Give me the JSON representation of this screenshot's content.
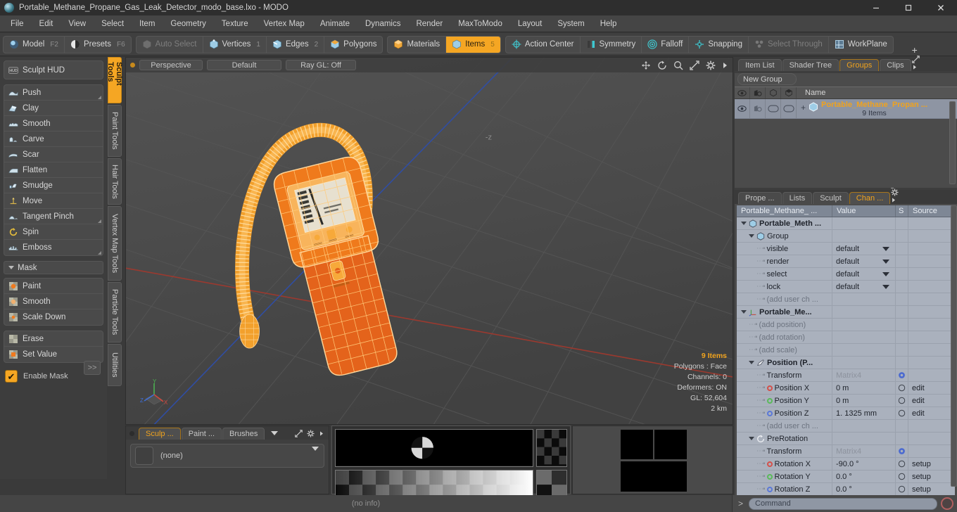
{
  "window": {
    "title": "Portable_Methane_Propane_Gas_Leak_Detector_modo_base.lxo - MODO",
    "logo_icon": "modo-logo-icon",
    "minimize_icon": "minimize-icon",
    "maximize_icon": "maximize-icon",
    "close_icon": "close-icon"
  },
  "menubar": {
    "items": [
      {
        "label": "File"
      },
      {
        "label": "Edit"
      },
      {
        "label": "View"
      },
      {
        "label": "Select"
      },
      {
        "label": "Item"
      },
      {
        "label": "Geometry"
      },
      {
        "label": "Texture"
      },
      {
        "label": "Vertex Map"
      },
      {
        "label": "Animate"
      },
      {
        "label": "Dynamics"
      },
      {
        "label": "Render"
      },
      {
        "label": "MaxToModo"
      },
      {
        "label": "Layout"
      },
      {
        "label": "System"
      },
      {
        "label": "Help"
      }
    ]
  },
  "modebar": {
    "group_mode": [
      {
        "label": "Model",
        "kbd": "F2",
        "icon": "sphere-blue-icon",
        "active": false,
        "dim": false
      },
      {
        "label": "Presets",
        "kbd": "F6",
        "icon": "sphere-half-icon",
        "active": false,
        "dim": false
      }
    ],
    "group_select": [
      {
        "label": "Auto Select",
        "kbd": "",
        "icon": "cube-grey-icon",
        "active": false,
        "dim": true
      },
      {
        "label": "Vertices",
        "kbd": "1",
        "icon": "cube-vertex-icon",
        "active": false,
        "dim": false
      },
      {
        "label": "Edges",
        "kbd": "2",
        "icon": "cube-edge-icon",
        "active": false,
        "dim": false
      },
      {
        "label": "Polygons",
        "kbd": "",
        "icon": "cube-poly-icon",
        "active": false,
        "dim": false
      }
    ],
    "group_items": [
      {
        "label": "Materials",
        "kbd": "",
        "icon": "cube-material-icon",
        "active": false,
        "dim": false
      },
      {
        "label": "Items",
        "kbd": "5",
        "icon": "cube-items-icon",
        "active": true,
        "dim": false
      }
    ],
    "group_tools": [
      {
        "label": "Action Center",
        "kbd": "",
        "icon": "action-center-icon",
        "active": false,
        "dim": false
      },
      {
        "label": "Symmetry",
        "kbd": "",
        "icon": "symmetry-icon",
        "active": false,
        "dim": false
      },
      {
        "label": "Falloff",
        "kbd": "",
        "icon": "falloff-icon",
        "active": false,
        "dim": false
      },
      {
        "label": "Snapping",
        "kbd": "",
        "icon": "snapping-icon",
        "active": false,
        "dim": false
      },
      {
        "label": "Select Through",
        "kbd": "",
        "icon": "select-through-icon",
        "active": false,
        "dim": true
      },
      {
        "label": "WorkPlane",
        "kbd": "",
        "icon": "workplane-icon",
        "active": false,
        "dim": false
      }
    ]
  },
  "left_panel": {
    "hud_button": {
      "label": "Sculpt HUD",
      "icon": "hud-icon"
    },
    "sculpt_tools": [
      {
        "label": "Push",
        "icon": "push-icon",
        "corner": true
      },
      {
        "label": "Clay",
        "icon": "clay-icon",
        "corner": false
      },
      {
        "label": "Smooth",
        "icon": "smooth-icon",
        "corner": false
      },
      {
        "label": "Carve",
        "icon": "carve-icon",
        "corner": false
      },
      {
        "label": "Scar",
        "icon": "scar-icon",
        "corner": false
      },
      {
        "label": "Flatten",
        "icon": "flatten-icon",
        "corner": false
      },
      {
        "label": "Smudge",
        "icon": "smudge-icon",
        "corner": false
      },
      {
        "label": "Move",
        "icon": "move-icon",
        "corner": false
      },
      {
        "label": "Tangent Pinch",
        "icon": "tangent-pinch-icon",
        "corner": true
      },
      {
        "label": "Spin",
        "icon": "spin-icon",
        "corner": false
      },
      {
        "label": "Emboss",
        "icon": "emboss-icon",
        "corner": true
      }
    ],
    "mask_section": {
      "label": "Mask",
      "tools": [
        {
          "label": "Paint",
          "icon": "mask-paint-icon"
        },
        {
          "label": "Smooth",
          "icon": "mask-smooth-icon"
        },
        {
          "label": "Scale Down",
          "icon": "mask-scale-down-icon"
        }
      ],
      "tools2": [
        {
          "label": "Erase",
          "icon": "mask-erase-icon"
        },
        {
          "label": "Set Value",
          "icon": "mask-set-value-icon"
        }
      ],
      "enable_mask": {
        "label": "Enable Mask",
        "checked": true
      },
      "more_label": ">>"
    },
    "vertical_tabs": [
      {
        "label": "Sculpt Tools",
        "active": true
      },
      {
        "label": "Paint Tools",
        "active": false
      },
      {
        "label": "Hair Tools",
        "active": false
      },
      {
        "label": "Vertex Map Tools",
        "active": false
      },
      {
        "label": "Particle Tools",
        "active": false
      },
      {
        "label": "Utilities",
        "active": false
      }
    ]
  },
  "viewport": {
    "header": {
      "view_mode": "Perspective",
      "shading": "Default",
      "raygl": "Ray GL: Off",
      "controls": [
        "pan-icon",
        "rotate-icon",
        "zoom-icon",
        "fit-icon",
        "gear-icon",
        "arrow-right-icon"
      ]
    },
    "info": {
      "items": "9 Items",
      "polygons": "Polygons : Face",
      "channels": "Channels: 0",
      "deformers": "Deformers: ON",
      "gl": "GL: 52,604",
      "scale": "2 km"
    },
    "axis_gizmo": {
      "x": "X",
      "y": "Y",
      "z": "Z"
    },
    "model_color_light": "#f5a623",
    "model_color_dark": "#e2621a"
  },
  "bottom_panel": {
    "tabs": [
      {
        "label": "Sculp ...",
        "active": true
      },
      {
        "label": "Paint ...",
        "active": false
      },
      {
        "label": "Brushes",
        "active": false
      }
    ],
    "caret_icon": "chevron-down-icon",
    "expand_icon": "expand-icon",
    "gear_icon": "gear-icon",
    "arrow_icon": "arrow-right-icon",
    "brush_value": "(none)"
  },
  "right_panel": {
    "top_tabs": [
      {
        "label": "Item List",
        "active": false
      },
      {
        "label": "Shader Tree",
        "active": false
      },
      {
        "label": "Groups",
        "active": true
      },
      {
        "label": "Clips",
        "active": false
      }
    ],
    "top_tab_extra": [
      "plus-icon",
      "expand-icon",
      "arrow-right-icon"
    ],
    "new_group_label": "New Group",
    "group_columns": [
      "eye-icon",
      "render-icon",
      "wire-icon",
      "shade-icon"
    ],
    "group_name_header": "Name",
    "group_row": {
      "name": "Portable_Methane_Propan ...",
      "sub": "9 Items",
      "item_icon": "group-cube-icon"
    },
    "bottom_tabs": [
      {
        "label": "Prope ...",
        "active": false
      },
      {
        "label": "Lists",
        "active": false
      },
      {
        "label": "Sculpt",
        "active": false
      },
      {
        "label": "Chan ...",
        "active": true
      }
    ],
    "bottom_tab_extra": [
      "plus-icon",
      "expand-icon",
      "gear-icon",
      "arrow-right-icon"
    ],
    "channel_headers": [
      "Portable_Methane_ ...",
      "Value",
      "S",
      "Source"
    ],
    "channels": [
      {
        "name": "Portable_Meth ...",
        "value": "",
        "src": "",
        "indent": 0,
        "tri": true,
        "bold": true,
        "icon": "group-cube-icon",
        "grey": false,
        "dot": "",
        "gear": false
      },
      {
        "name": "Group",
        "value": "",
        "src": "",
        "indent": 1,
        "tri": true,
        "bold": false,
        "icon": "group-cube-icon",
        "grey": false,
        "dot": "",
        "gear": false
      },
      {
        "name": "visible",
        "value": "default",
        "src": "",
        "indent": 2,
        "tri": false,
        "bold": false,
        "icon": "",
        "grey": false,
        "dot": "",
        "gear": false,
        "dropdown": true
      },
      {
        "name": "render",
        "value": "default",
        "src": "",
        "indent": 2,
        "tri": false,
        "bold": false,
        "icon": "",
        "grey": false,
        "dot": "",
        "gear": false,
        "dropdown": true
      },
      {
        "name": "select",
        "value": "default",
        "src": "",
        "indent": 2,
        "tri": false,
        "bold": false,
        "icon": "",
        "grey": false,
        "dot": "",
        "gear": false,
        "dropdown": true
      },
      {
        "name": "lock",
        "value": "default",
        "src": "",
        "indent": 2,
        "tri": false,
        "bold": false,
        "icon": "",
        "grey": false,
        "dot": "",
        "gear": false,
        "dropdown": true
      },
      {
        "name": "(add user ch ...",
        "value": "",
        "src": "",
        "indent": 2,
        "tri": false,
        "bold": false,
        "icon": "",
        "grey": true,
        "dot": "",
        "gear": false
      },
      {
        "name": "Portable_Me...",
        "value": "",
        "src": "",
        "indent": 0,
        "tri": true,
        "bold": true,
        "icon": "axis-icon",
        "grey": false,
        "dot": "",
        "gear": false
      },
      {
        "name": "(add position)",
        "value": "",
        "src": "",
        "indent": 1,
        "tri": false,
        "bold": false,
        "icon": "",
        "grey": true,
        "dot": "",
        "gear": false
      },
      {
        "name": "(add rotation)",
        "value": "",
        "src": "",
        "indent": 1,
        "tri": false,
        "bold": false,
        "icon": "",
        "grey": true,
        "dot": "",
        "gear": false
      },
      {
        "name": "(add scale)",
        "value": "",
        "src": "",
        "indent": 1,
        "tri": false,
        "bold": false,
        "icon": "",
        "grey": true,
        "dot": "",
        "gear": false
      },
      {
        "name": "Position (P...",
        "value": "",
        "src": "",
        "indent": 1,
        "tri": true,
        "bold": true,
        "icon": "position-icon",
        "grey": false,
        "dot": "",
        "gear": false
      },
      {
        "name": "Transform",
        "value": "Matrix4",
        "src": "",
        "indent": 2,
        "tri": false,
        "bold": false,
        "icon": "",
        "grey": false,
        "dot": "",
        "gear": true,
        "greyval": true
      },
      {
        "name": "Position X",
        "value": "0 m",
        "src": "edit",
        "indent": 2,
        "tri": false,
        "bold": false,
        "icon": "",
        "grey": false,
        "dot": "#d4504a",
        "gear": false,
        "circle": true
      },
      {
        "name": "Position Y",
        "value": "0 m",
        "src": "edit",
        "indent": 2,
        "tri": false,
        "bold": false,
        "icon": "",
        "grey": false,
        "dot": "#5aba5a",
        "gear": false,
        "circle": true
      },
      {
        "name": "Position Z",
        "value": "1. 1325 mm",
        "src": "edit",
        "indent": 2,
        "tri": false,
        "bold": false,
        "icon": "",
        "grey": false,
        "dot": "#5a78d8",
        "gear": false,
        "circle": true
      },
      {
        "name": "(add user ch ...",
        "value": "",
        "src": "",
        "indent": 2,
        "tri": false,
        "bold": false,
        "icon": "",
        "grey": true,
        "dot": "",
        "gear": false
      },
      {
        "name": "PreRotation",
        "value": "",
        "src": "",
        "indent": 1,
        "tri": true,
        "bold": false,
        "icon": "prerotation-icon",
        "grey": false,
        "dot": "",
        "gear": false
      },
      {
        "name": "Transform",
        "value": "Matrix4",
        "src": "",
        "indent": 2,
        "tri": false,
        "bold": false,
        "icon": "",
        "grey": false,
        "dot": "",
        "gear": true,
        "greyval": true
      },
      {
        "name": "Rotation X",
        "value": "-90.0 °",
        "src": "setup",
        "indent": 2,
        "tri": false,
        "bold": false,
        "icon": "",
        "grey": false,
        "dot": "#d4504a",
        "gear": false,
        "circle": true
      },
      {
        "name": "Rotation Y",
        "value": "0.0 °",
        "src": "setup",
        "indent": 2,
        "tri": false,
        "bold": false,
        "icon": "",
        "grey": false,
        "dot": "#5aba5a",
        "gear": false,
        "circle": true
      },
      {
        "name": "Rotation Z",
        "value": "0.0 °",
        "src": "setup",
        "indent": 2,
        "tri": false,
        "bold": false,
        "icon": "",
        "grey": false,
        "dot": "#5a78d8",
        "gear": false,
        "circle": true
      }
    ]
  },
  "statusbar": {
    "info": "(no info)",
    "prompt": ">",
    "command_placeholder": "Command",
    "record_icon": "record-icon"
  }
}
